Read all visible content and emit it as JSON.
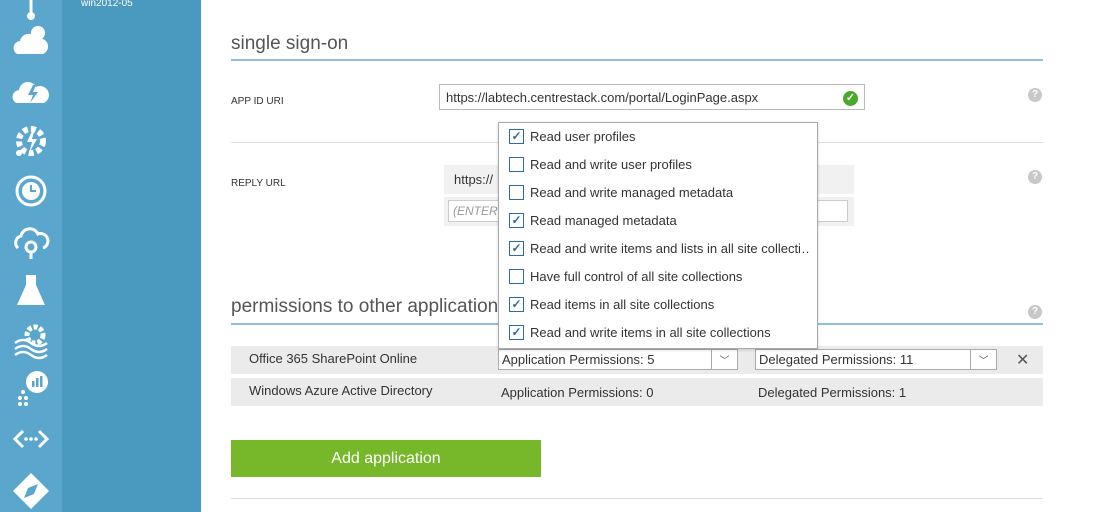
{
  "nav": {
    "rail_icons": [
      "thermometer-icon",
      "cloud-services-icon",
      "cloud-bolt-icon",
      "gear-bolt-icon",
      "clock-refresh-icon",
      "cloud-link-icon",
      "flask-icon",
      "settings-waves-icon",
      "analytics-icon",
      "code-arrows-icon",
      "compass-icon"
    ],
    "item_label": "win2012-05"
  },
  "sso": {
    "title": "single sign-on",
    "app_id_label": "APP ID URI",
    "app_id_value": "https://labtech.centrestack.com/portal/LoginPage.aspx",
    "reply_url_label": "REPLY URL",
    "reply_url_value": "https://",
    "reply_url_placeholder": "(ENTER"
  },
  "permissions": {
    "title": "permissions to other application",
    "rows": [
      {
        "app": "Office 365 SharePoint Online",
        "application_perms": "Application Permissions: 5",
        "delegated_perms": "Delegated Permissions: 11",
        "remove": "✕"
      },
      {
        "app": "Windows Azure Active Directory",
        "application_perms": "Application Permissions: 0",
        "delegated_perms": "Delegated Permissions: 1"
      }
    ],
    "dropdown_options": [
      {
        "label": "Read user profiles",
        "checked": true
      },
      {
        "label": "Read and write user profiles",
        "checked": false
      },
      {
        "label": "Read and write managed metadata",
        "checked": false
      },
      {
        "label": "Read managed metadata",
        "checked": true
      },
      {
        "label": "Read and write items and lists in all site collecti…",
        "checked": true
      },
      {
        "label": "Have full control of all site collections",
        "checked": false
      },
      {
        "label": "Read items in all site collections",
        "checked": true
      },
      {
        "label": "Read and write items in all site collections",
        "checked": true
      }
    ],
    "add_button": "Add application"
  },
  "help_glyph": "?",
  "colors": {
    "rail": "#5aa6cc",
    "nav2": "#4a9ac0",
    "accent_green": "#76b82a",
    "checkbox": "#2e6da4"
  }
}
